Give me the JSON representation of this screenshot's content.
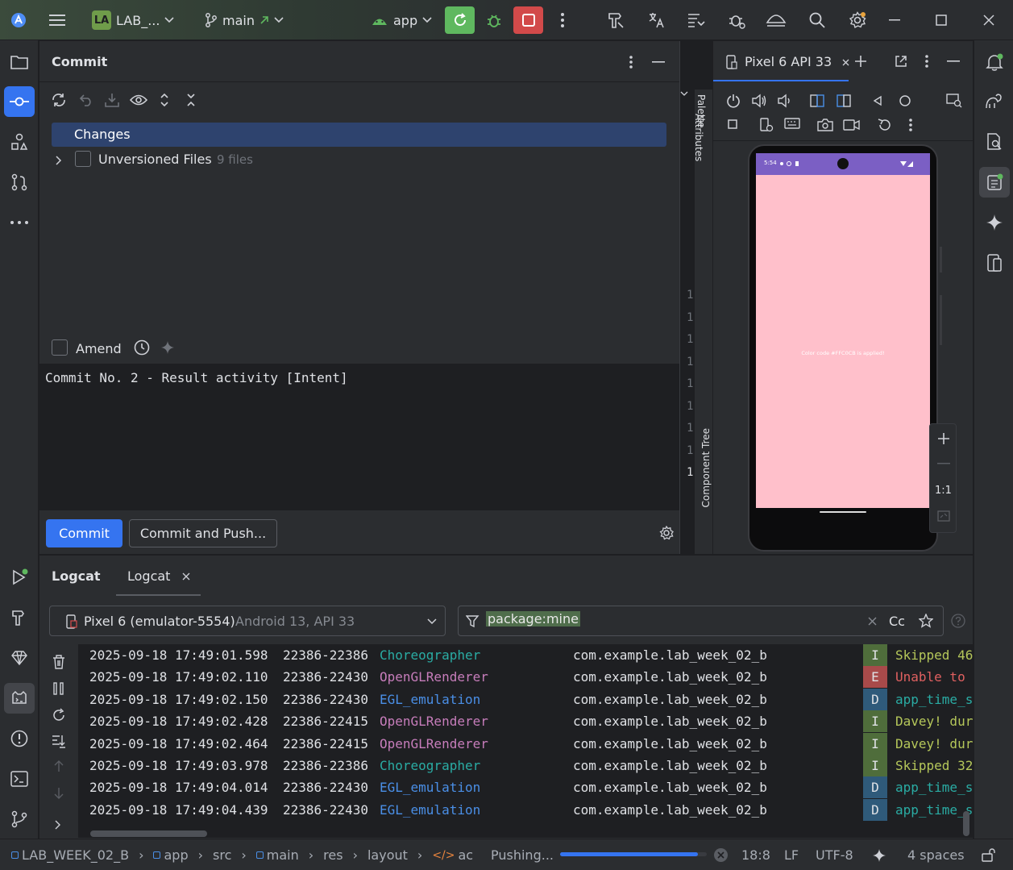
{
  "colors": {
    "accent": "#3574f0",
    "selection": "#2e436e",
    "run_green": "#5fb85f",
    "stop_red": "#d24a4a",
    "phone_screen": "#ffc0cb",
    "phone_status_bar": "#7b5fc4"
  },
  "titlebar": {
    "project_badge": "LA",
    "project_name": "LAB_...",
    "branch": "main",
    "run_config": "app"
  },
  "commit": {
    "title": "Commit",
    "changes_label": "Changes",
    "unversioned_label": "Unversioned Files",
    "unversioned_count": "9 files",
    "amend_label": "Amend",
    "message": "Commit No. 2 - Result activity [Intent]",
    "commit_button": "Commit",
    "commit_push_button": "Commit and Push..."
  },
  "gutter": {
    "line_numbers": [
      "1",
      "1",
      "1",
      "1",
      "1",
      "1",
      "1",
      "1",
      "1"
    ],
    "side_tabs": {
      "palette": "Palette",
      "attributes": "Attributes",
      "component_tree": "Component Tree"
    }
  },
  "device": {
    "tab_title": "Pixel 6 API 33",
    "phone_time": "5:54",
    "phone_center_text": "Color code #FFC0CB is applied!",
    "zoom_label": "1:1"
  },
  "logcat": {
    "tab_main": "Logcat",
    "tab_sub": "Logcat",
    "device_selector": "Pixel 6 (emulator-5554)",
    "device_selector_detail": "Android 13, API 33",
    "filter_text": "package:mine",
    "case_label": "Cc",
    "lines": [
      {
        "ts": "2025-09-18 17:49:01.598",
        "pid": "22386-22386",
        "tag": "Choreographer",
        "tag_color": "#2aaca4",
        "pkg": "com.example.lab_week_02_b",
        "level": "I",
        "msg": "Skipped 46"
      },
      {
        "ts": "2025-09-18 17:49:02.110",
        "pid": "22386-22430",
        "tag": "OpenGLRenderer",
        "tag_color": "#c77dbb",
        "pkg": "com.example.lab_week_02_b",
        "level": "E",
        "msg": "Unable to"
      },
      {
        "ts": "2025-09-18 17:49:02.150",
        "pid": "22386-22430",
        "tag": "EGL_emulation",
        "tag_color": "#4a8fe7",
        "pkg": "com.example.lab_week_02_b",
        "level": "D",
        "msg": "app_time_s"
      },
      {
        "ts": "2025-09-18 17:49:02.428",
        "pid": "22386-22415",
        "tag": "OpenGLRenderer",
        "tag_color": "#c77dbb",
        "pkg": "com.example.lab_week_02_b",
        "level": "I",
        "msg": "Davey! dur"
      },
      {
        "ts": "2025-09-18 17:49:02.464",
        "pid": "22386-22415",
        "tag": "OpenGLRenderer",
        "tag_color": "#c77dbb",
        "pkg": "com.example.lab_week_02_b",
        "level": "I",
        "msg": "Davey! dur"
      },
      {
        "ts": "2025-09-18 17:49:03.978",
        "pid": "22386-22386",
        "tag": "Choreographer",
        "tag_color": "#2aaca4",
        "pkg": "com.example.lab_week_02_b",
        "level": "I",
        "msg": "Skipped 32"
      },
      {
        "ts": "2025-09-18 17:49:04.014",
        "pid": "22386-22430",
        "tag": "EGL_emulation",
        "tag_color": "#4a8fe7",
        "pkg": "com.example.lab_week_02_b",
        "level": "D",
        "msg": "app_time_s"
      },
      {
        "ts": "2025-09-18 17:49:04.439",
        "pid": "22386-22430",
        "tag": "EGL_emulation",
        "tag_color": "#4a8fe7",
        "pkg": "com.example.lab_week_02_b",
        "level": "D",
        "msg": "app_time_s"
      }
    ]
  },
  "statusbar": {
    "breadcrumb": [
      "LAB_WEEK_02_B",
      "app",
      "src",
      "main",
      "res",
      "layout",
      "ac"
    ],
    "task_label": "Pushing...",
    "task_progress": 0.94,
    "position": "18:8",
    "line_sep": "LF",
    "encoding": "UTF-8",
    "indent": "4 spaces"
  }
}
